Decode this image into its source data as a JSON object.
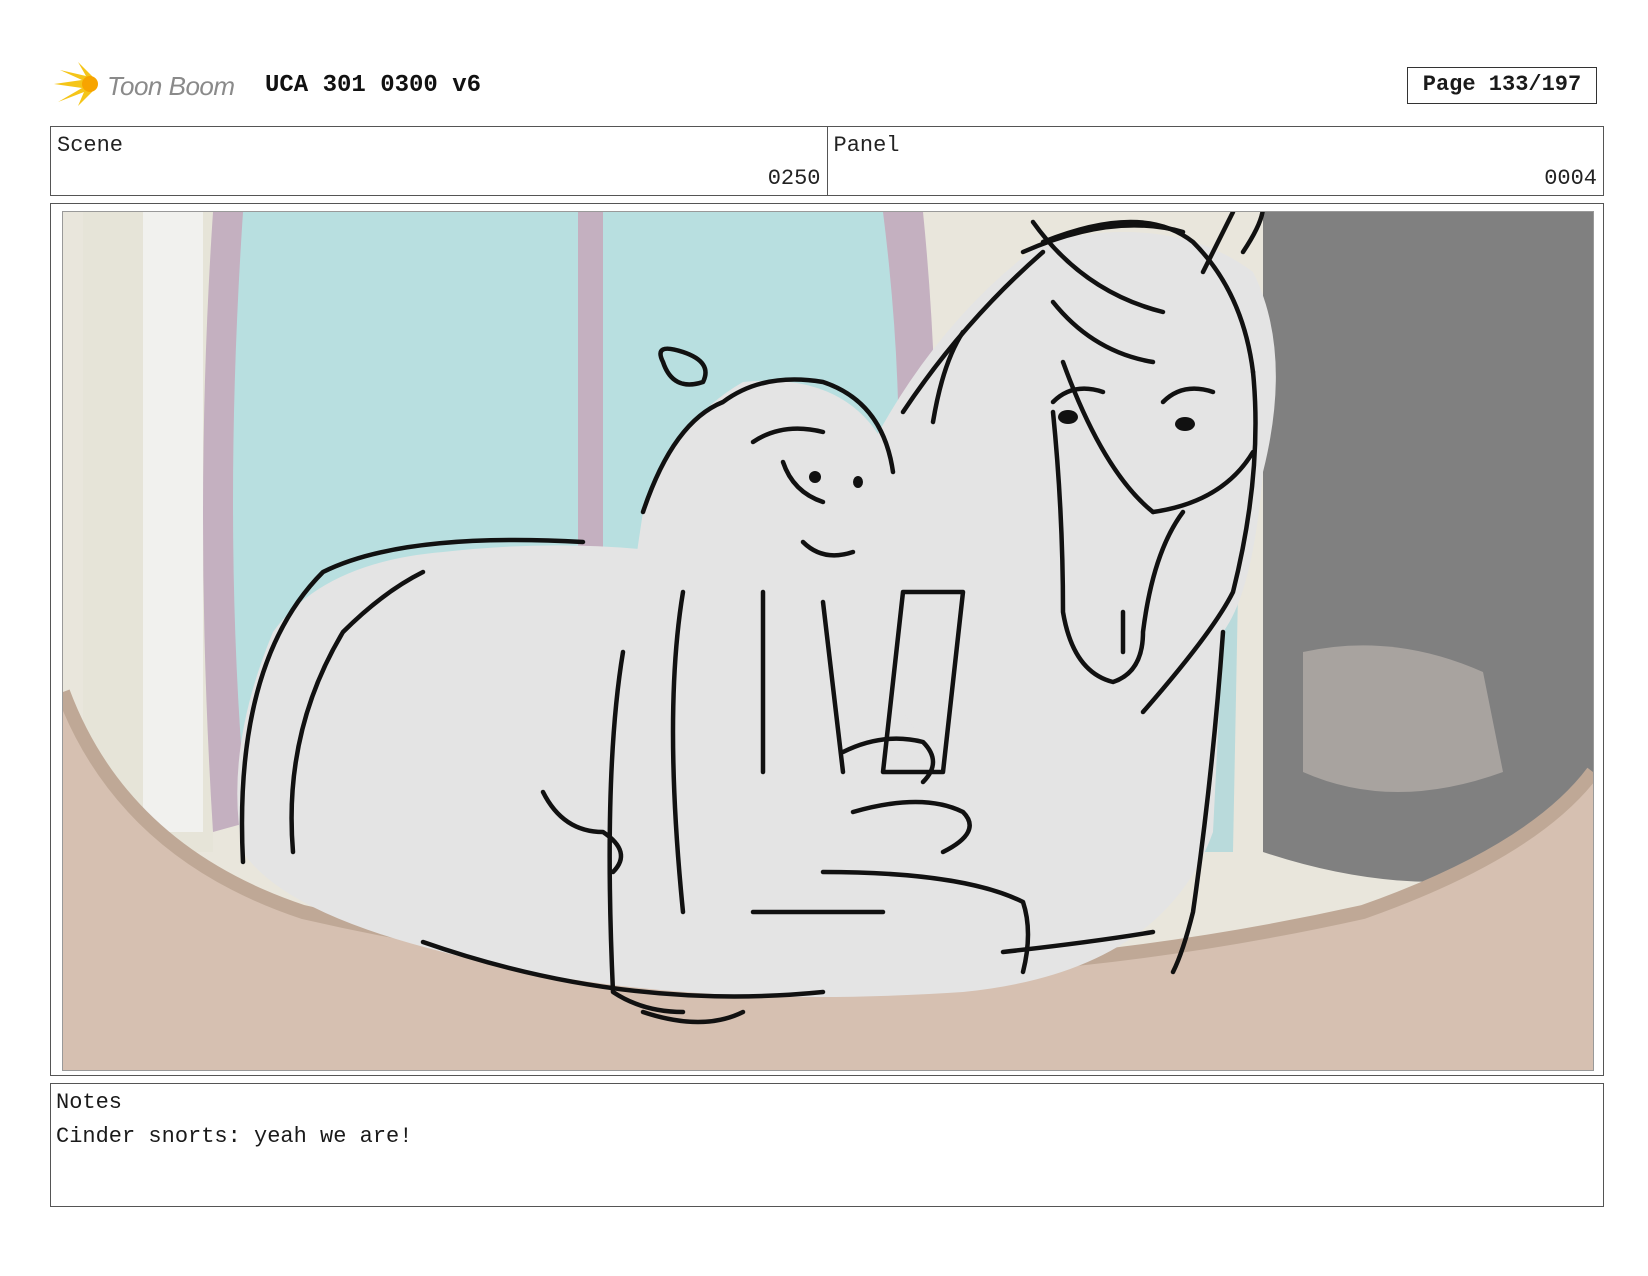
{
  "header": {
    "logo_text": "Toon Boom",
    "title": "UCA 301 0300 v6",
    "page": "Page 133/197"
  },
  "info": {
    "scene_label": "Scene",
    "scene_value": "0250",
    "panel_label": "Panel",
    "panel_value": "0004"
  },
  "notes": {
    "label": "Notes",
    "text": "Cinder snorts: yeah we are!"
  },
  "colors": {
    "logo_yellow": "#f5c518",
    "sky": "#b8dfe0",
    "window_frame": "#c4b0c0",
    "floor": "#d6c0b1",
    "stall_shadow": "#808080",
    "horse_fill": "#e4e4e4",
    "line": "#111111"
  }
}
